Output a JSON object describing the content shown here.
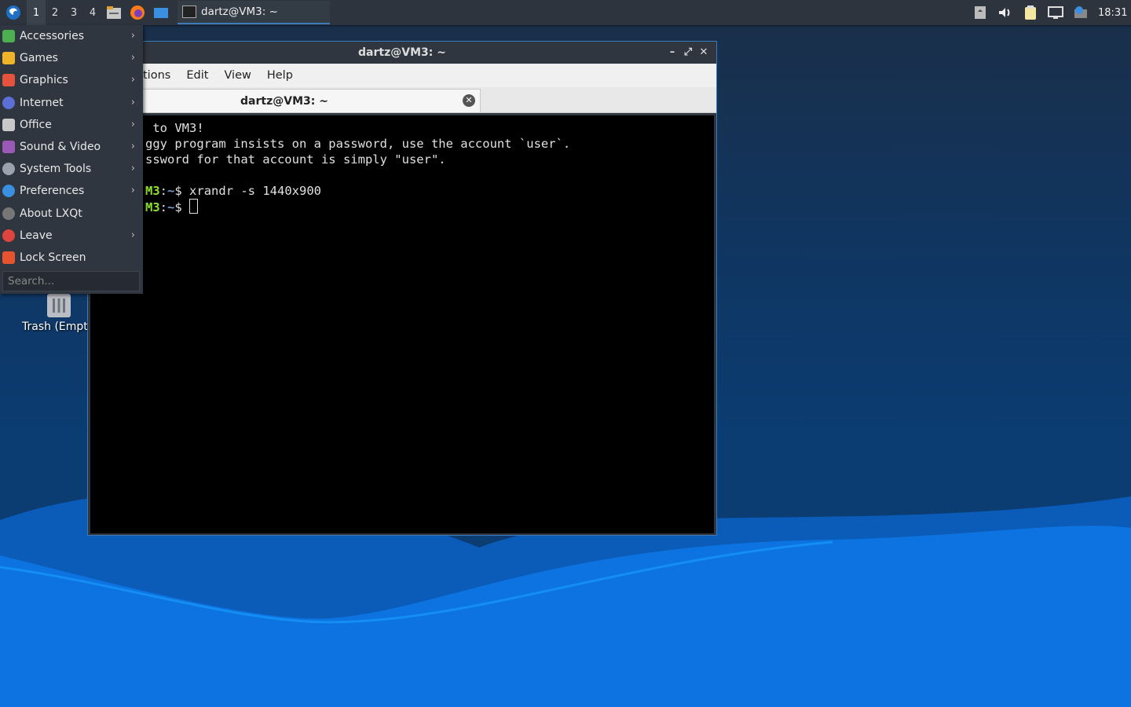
{
  "taskbar": {
    "workspaces": [
      "1",
      "2",
      "3",
      "4"
    ],
    "active_workspace": "1",
    "quicklaunch_icons": [
      "file-manager-icon",
      "firefox-icon",
      "desktop-icon"
    ],
    "task_title": "dartz@VM3: ~",
    "tray_icons": [
      "keyboard-layout-icon",
      "volume-icon",
      "clipboard-icon",
      "network-icon",
      "update-notifier-icon"
    ],
    "clock": "18:31"
  },
  "menu": {
    "items": [
      {
        "label": "Accessories",
        "icon": "accessories-icon",
        "color": "#4caf50",
        "submenu": true
      },
      {
        "label": "Games",
        "icon": "games-icon",
        "color": "#f0b429",
        "submenu": true
      },
      {
        "label": "Graphics",
        "icon": "graphics-icon",
        "color": "#e5533c",
        "submenu": true
      },
      {
        "label": "Internet",
        "icon": "internet-icon",
        "color": "#5b6fd6",
        "submenu": true
      },
      {
        "label": "Office",
        "icon": "office-icon",
        "color": "#c9c9c9",
        "submenu": true
      },
      {
        "label": "Sound & Video",
        "icon": "sound-video-icon",
        "color": "#9b59b6",
        "submenu": true
      },
      {
        "label": "System Tools",
        "icon": "system-tools-icon",
        "color": "#9aa3ad",
        "submenu": true
      },
      {
        "label": "Preferences",
        "icon": "preferences-icon",
        "color": "#3b8fe0",
        "submenu": true
      },
      {
        "label": "About LXQt",
        "icon": "info-icon",
        "color": "#777",
        "submenu": false
      },
      {
        "label": "Leave",
        "icon": "power-icon",
        "color": "#e0443e",
        "submenu": true
      },
      {
        "label": "Lock Screen",
        "icon": "lock-icon",
        "color": "#e8532f",
        "submenu": false
      }
    ],
    "search_placeholder": "Search..."
  },
  "desktop": {
    "trash_label": "Trash (Empty)"
  },
  "window": {
    "title": "dartz@VM3: ~",
    "menu_items": [
      "Actions",
      "Edit",
      "View",
      "Help"
    ],
    "menu_visible": [
      "tions",
      "Edit",
      "View",
      "Help"
    ],
    "tab_title": "dartz@VM3: ~",
    "terminal_lines": [
      " to VM3!",
      "ggy program insists on a password, use the account `user`.",
      "ssword for that account is simply \"user\"."
    ],
    "prompt_host": "M3",
    "prompt_path": "~",
    "command": "xrandr -s 1440x900"
  }
}
